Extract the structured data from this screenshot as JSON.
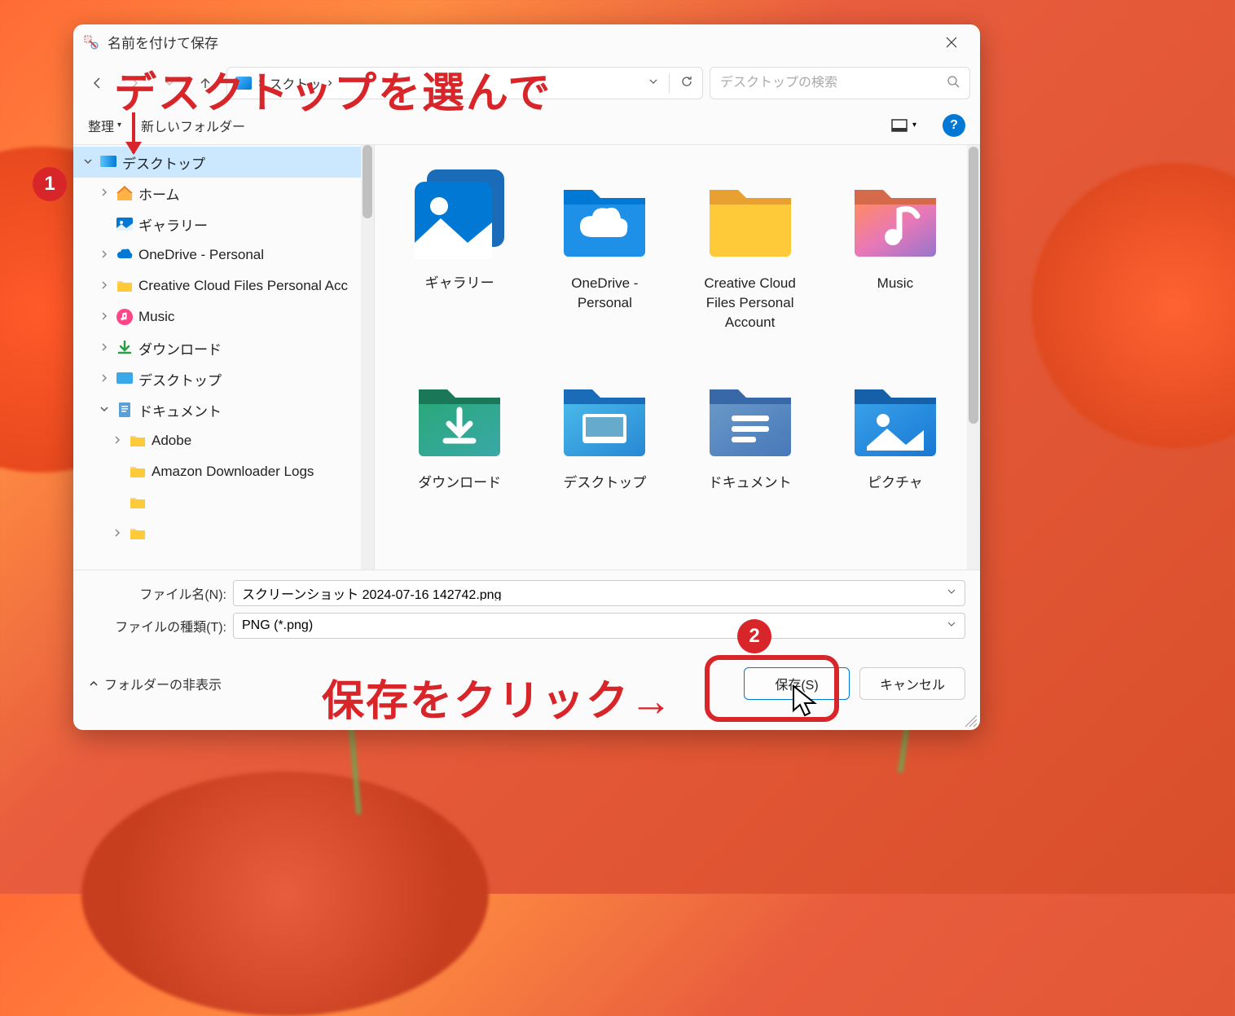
{
  "window": {
    "title": "名前を付けて保存"
  },
  "nav": {
    "breadcrumb_current": "スクトッ",
    "breadcrumb_sep": "›"
  },
  "search": {
    "placeholder": "デスクトップの検索"
  },
  "toolbar": {
    "organize": "整理",
    "new_folder": "新しいフォルダー",
    "help": "?"
  },
  "tree": {
    "items": [
      {
        "indent": 0,
        "label": "デスクトップ",
        "icon": "desktop",
        "chev": "v",
        "selected": true
      },
      {
        "indent": 1,
        "label": "ホーム",
        "icon": "home",
        "chev": ">"
      },
      {
        "indent": 1,
        "label": "ギャラリー",
        "icon": "gallery",
        "chev": ""
      },
      {
        "indent": 1,
        "label": "OneDrive - Personal",
        "icon": "onedrive",
        "chev": ">"
      },
      {
        "indent": 1,
        "label": "Creative Cloud Files Personal Acc",
        "icon": "folder",
        "chev": ">"
      },
      {
        "indent": 1,
        "label": "Music",
        "icon": "music",
        "chev": ">"
      },
      {
        "indent": 1,
        "label": "ダウンロード",
        "icon": "download",
        "chev": ">"
      },
      {
        "indent": 1,
        "label": "デスクトップ",
        "icon": "desktop-sm",
        "chev": ">"
      },
      {
        "indent": 1,
        "label": "ドキュメント",
        "icon": "document",
        "chev": "v"
      },
      {
        "indent": 2,
        "label": "Adobe",
        "icon": "folder",
        "chev": ">"
      },
      {
        "indent": 2,
        "label": "Amazon Downloader Logs",
        "icon": "folder",
        "chev": ""
      },
      {
        "indent": 2,
        "label": "",
        "icon": "folder",
        "chev": ""
      },
      {
        "indent": 2,
        "label": "",
        "icon": "folder",
        "chev": ">"
      }
    ]
  },
  "files": {
    "items": [
      {
        "label": "ギャラリー",
        "icon": "gallery"
      },
      {
        "label": "OneDrive - Personal",
        "icon": "onedrive"
      },
      {
        "label": "Creative Cloud Files Personal Account",
        "icon": "ccfolder"
      },
      {
        "label": "Music",
        "icon": "music"
      },
      {
        "label": "ダウンロード",
        "icon": "download"
      },
      {
        "label": "デスクトップ",
        "icon": "desktop"
      },
      {
        "label": "ドキュメント",
        "icon": "document"
      },
      {
        "label": "ピクチャ",
        "icon": "pictures"
      }
    ]
  },
  "fields": {
    "filename_label": "ファイル名(N):",
    "filename_value": "スクリーンショット 2024-07-16 142742.png",
    "filetype_label": "ファイルの種類(T):",
    "filetype_value": "PNG (*.png)"
  },
  "footer": {
    "hide_folders": "フォルダーの非表示",
    "save": "保存(S)",
    "cancel": "キャンセル"
  },
  "annotations": {
    "text1": "デスクトップを選んで",
    "text2": "保存をクリック→",
    "badge1": "1",
    "badge2": "2"
  }
}
